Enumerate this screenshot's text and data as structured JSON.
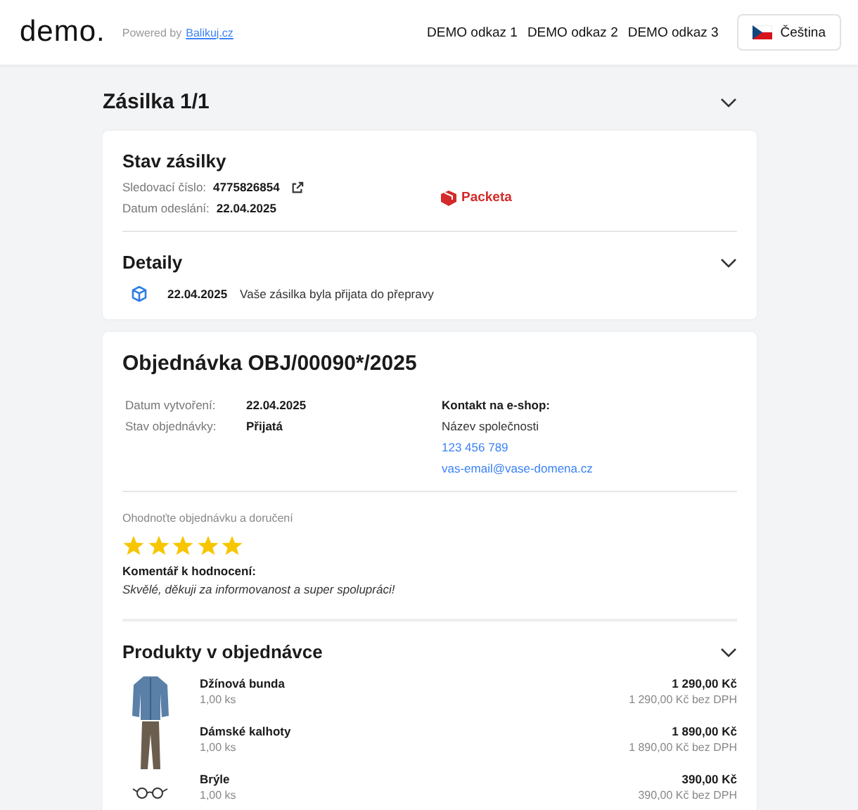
{
  "header": {
    "logo": "demo.",
    "powered_by": "Powered by",
    "powered_link": "Balikuj.cz",
    "links": [
      "DEMO odkaz 1",
      "DEMO odkaz 2",
      "DEMO odkaz 3"
    ],
    "language": "Čeština"
  },
  "shipment": {
    "title": "Zásilka 1/1",
    "expanded": true,
    "status": {
      "title": "Stav zásilky",
      "tracking_label": "Sledovací číslo:",
      "tracking_number": "4775826854",
      "sent_label": "Datum odeslání:",
      "sent_date": "22.04.2025",
      "carrier": "Packeta"
    },
    "details": {
      "title": "Detaily",
      "expanded": true,
      "events": [
        {
          "date": "22.04.2025",
          "text": "Vaše zásilka byla přijata do přepravy"
        }
      ]
    }
  },
  "order": {
    "title": "Objednávka OBJ/00090*/2025",
    "fields": [
      {
        "label": "Datum vytvoření:",
        "value": "22.04.2025"
      },
      {
        "label": "Stav objednávky:",
        "value": "Přijatá"
      }
    ],
    "contact": {
      "title": "Kontakt na e-shop:",
      "company": "Název společnosti",
      "phone": "123 456 789",
      "email": "vas-email@vase-domena.cz"
    },
    "rating": {
      "prompt": "Ohodnoťte objednávku a doručení",
      "stars": 5,
      "comment_label": "Komentář k hodnocení:",
      "comment": "Skvělé, děkuji za informovanost a super spolupráci!"
    },
    "products": {
      "title": "Produkty v objednávce",
      "expanded": true,
      "items": [
        {
          "kind": "jacket",
          "name": "Džínová bunda",
          "qty": "1,00 ks",
          "price": "1 290,00 Kč",
          "price_net": "1 290,00 Kč bez DPH"
        },
        {
          "kind": "trousers",
          "name": "Dámské kalhoty",
          "qty": "1,00 ks",
          "price": "1 890,00 Kč",
          "price_net": "1 890,00 Kč bez DPH"
        },
        {
          "kind": "glasses",
          "name": "Brýle",
          "qty": "1,00 ks",
          "price": "390,00 Kč",
          "price_net": "390,00 Kč bez DPH"
        }
      ]
    }
  }
}
